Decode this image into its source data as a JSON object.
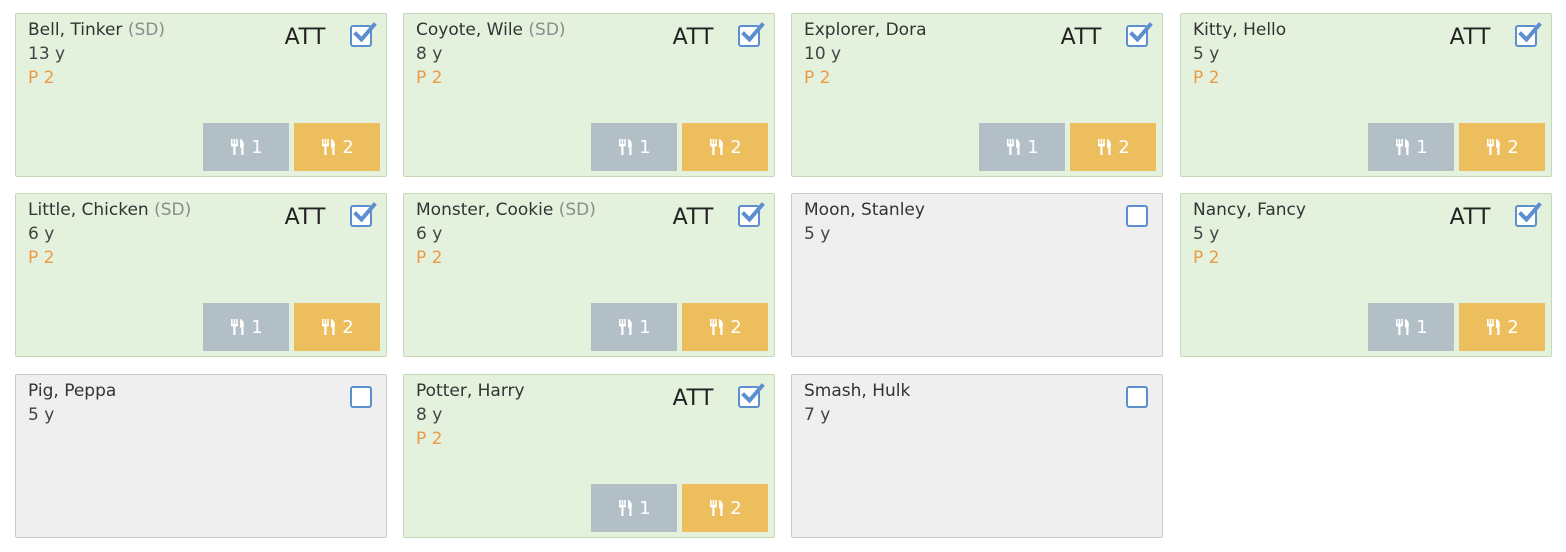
{
  "colors": {
    "present_card": "#e4f1dc",
    "absent_card": "#efefef",
    "period_text": "#eb9a45",
    "meal1_button": "#b3bfc7",
    "meal2_button": "#ecbe5e",
    "checkbox_accent": "#5b8fd0"
  },
  "icons": {
    "meal": "fork-knife-icon",
    "check": "checkbox-check-icon"
  },
  "students": [
    {
      "name": "Bell, Tinker",
      "sd": "(SD)",
      "age": "13 y",
      "period": "P 2",
      "att": "ATT",
      "checked": true,
      "meal1": "1",
      "meal2": "2"
    },
    {
      "name": "Coyote, Wile",
      "sd": "(SD)",
      "age": "8 y",
      "period": "P 2",
      "att": "ATT",
      "checked": true,
      "meal1": "1",
      "meal2": "2"
    },
    {
      "name": "Explorer, Dora",
      "sd": "",
      "age": "10 y",
      "period": "P 2",
      "att": "ATT",
      "checked": true,
      "meal1": "1",
      "meal2": "2"
    },
    {
      "name": "Kitty, Hello",
      "sd": "",
      "age": "5 y",
      "period": "P 2",
      "att": "ATT",
      "checked": true,
      "meal1": "1",
      "meal2": "2"
    },
    {
      "name": "Little, Chicken",
      "sd": "(SD)",
      "age": "6 y",
      "period": "P 2",
      "att": "ATT",
      "checked": true,
      "meal1": "1",
      "meal2": "2"
    },
    {
      "name": "Monster, Cookie",
      "sd": "(SD)",
      "age": "6 y",
      "period": "P 2",
      "att": "ATT",
      "checked": true,
      "meal1": "1",
      "meal2": "2"
    },
    {
      "name": "Moon, Stanley",
      "sd": "",
      "age": "5 y",
      "period": "",
      "att": "",
      "checked": false,
      "meal1": "",
      "meal2": ""
    },
    {
      "name": "Nancy, Fancy",
      "sd": "",
      "age": "5 y",
      "period": "P 2",
      "att": "ATT",
      "checked": true,
      "meal1": "1",
      "meal2": "2"
    },
    {
      "name": "Pig, Peppa",
      "sd": "",
      "age": "5 y",
      "period": "",
      "att": "",
      "checked": false,
      "meal1": "",
      "meal2": ""
    },
    {
      "name": "Potter, Harry",
      "sd": "",
      "age": "8 y",
      "period": "P 2",
      "att": "ATT",
      "checked": true,
      "meal1": "1",
      "meal2": "2"
    },
    {
      "name": "Smash, Hulk",
      "sd": "",
      "age": "7 y",
      "period": "",
      "att": "",
      "checked": false,
      "meal1": "",
      "meal2": ""
    }
  ]
}
